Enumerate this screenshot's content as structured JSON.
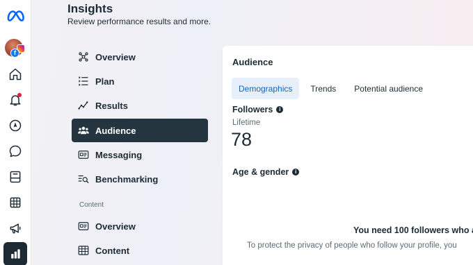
{
  "rail": {
    "items": [
      {
        "name": "meta-logo-icon"
      },
      {
        "name": "account-avatar"
      },
      {
        "name": "home-icon"
      },
      {
        "name": "notifications-icon"
      },
      {
        "name": "compass-icon"
      },
      {
        "name": "messages-icon"
      },
      {
        "name": "content-icon"
      },
      {
        "name": "planner-grid-icon"
      },
      {
        "name": "ads-megaphone-icon"
      },
      {
        "name": "insights-chart-icon"
      }
    ],
    "accent": "#0866ff",
    "notification_dot_color": "#e41e3f"
  },
  "header": {
    "title": "Insights",
    "subtitle": "Review performance results and more."
  },
  "nav": {
    "items": [
      {
        "label": "Overview",
        "icon": "network-icon"
      },
      {
        "label": "Plan",
        "icon": "list-icon"
      },
      {
        "label": "Results",
        "icon": "trend-icon"
      },
      {
        "label": "Audience",
        "icon": "people-icon",
        "active": true
      },
      {
        "label": "Messaging",
        "icon": "inbox-icon"
      },
      {
        "label": "Benchmarking",
        "icon": "search-list-icon"
      }
    ],
    "section_label": "Content",
    "section_items": [
      {
        "label": "Overview",
        "icon": "inbox-icon"
      },
      {
        "label": "Content",
        "icon": "table-icon"
      }
    ],
    "active_color": "#253540"
  },
  "main": {
    "title": "Audience",
    "tabs": [
      {
        "label": "Demographics",
        "active": true
      },
      {
        "label": "Trends"
      },
      {
        "label": "Potential audience"
      }
    ],
    "followers": {
      "heading": "Followers",
      "period": "Lifetime",
      "count": "78"
    },
    "age_gender": {
      "heading": "Age & gender",
      "empty_title": "You need 100 followers who a",
      "empty_body": "To protect the privacy of people who follow your profile, you"
    },
    "tab_active_color": "#0b64c0"
  }
}
